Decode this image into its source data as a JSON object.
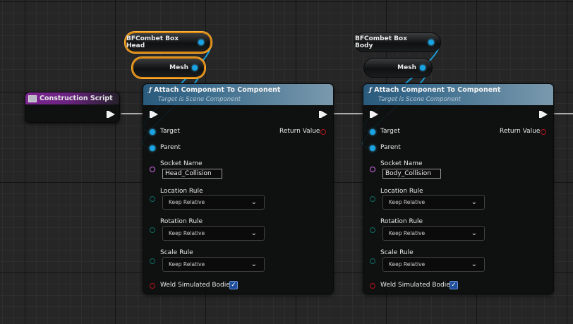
{
  "graph": {
    "construction_script": {
      "title": "Construction Script"
    },
    "getters": [
      {
        "label": "BFCombet Box Head"
      },
      {
        "label": "Mesh"
      },
      {
        "label": "BFCombet Box Body"
      },
      {
        "label": "Mesh"
      }
    ],
    "nodes": [
      {
        "title": "Attach Component To Component",
        "subtitle": "Target is Scene Component",
        "target_label": "Target",
        "parent_label": "Parent",
        "return_label": "Return Value",
        "socket_label": "Socket Name",
        "socket_value": "Head_Collision",
        "location_rule_label": "Location Rule",
        "location_rule_value": "Keep Relative",
        "rotation_rule_label": "Rotation Rule",
        "rotation_rule_value": "Keep Relative",
        "scale_rule_label": "Scale Rule",
        "scale_rule_value": "Keep Relative",
        "weld_label": "Weld Simulated Bodies",
        "weld_checked": true
      },
      {
        "title": "Attach Component To Component",
        "subtitle": "Target is Scene Component",
        "target_label": "Target",
        "parent_label": "Parent",
        "return_label": "Return Value",
        "socket_label": "Socket Name",
        "socket_value": "Body_Collision",
        "location_rule_label": "Location Rule",
        "location_rule_value": "Keep Relative",
        "rotation_rule_label": "Rotation Rule",
        "rotation_rule_value": "Keep Relative",
        "scale_rule_label": "Scale Rule",
        "scale_rule_value": "Keep Relative",
        "weld_label": "Weld Simulated Bodies",
        "weld_checked": true
      }
    ]
  },
  "icons": {
    "function": "function-icon",
    "event": "event-icon",
    "chevron": "chevron-down-icon",
    "check": "checkmark-icon"
  },
  "colors": {
    "object_pin": "#1aa3e3",
    "string_pin": "#d066e8",
    "enum_pin": "#0f6b62",
    "bool_pin": "#b0141a",
    "selection": "#e08a10",
    "event_header": "#7c2590",
    "function_header": "#2a5a7c"
  }
}
